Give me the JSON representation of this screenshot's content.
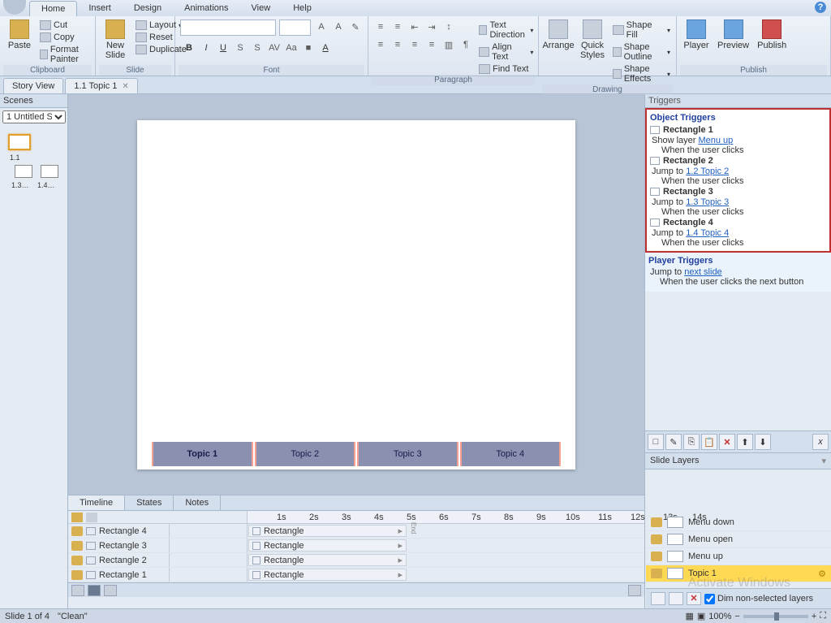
{
  "menu": {
    "tabs": [
      "Home",
      "Insert",
      "Design",
      "Animations",
      "View",
      "Help"
    ],
    "active": "Home"
  },
  "ribbon": {
    "clipboard": {
      "title": "Clipboard",
      "paste": "Paste",
      "cut": "Cut",
      "copy": "Copy",
      "painter": "Format Painter"
    },
    "slide": {
      "title": "Slide",
      "new": "New\nSlide",
      "layout": "Layout",
      "reset": "Reset",
      "dup": "Duplicate"
    },
    "font": {
      "title": "Font"
    },
    "paragraph": {
      "title": "Paragraph",
      "textdir": "Text Direction",
      "align": "Align Text",
      "find": "Find Text"
    },
    "drawing": {
      "title": "Drawing",
      "arrange": "Arrange",
      "quick": "Quick\nStyles",
      "fill": "Shape Fill",
      "outline": "Shape Outline",
      "effects": "Shape Effects"
    },
    "publish": {
      "title": "Publish",
      "player": "Player",
      "preview": "Preview",
      "pub": "Publish"
    }
  },
  "doctabs": {
    "story": "Story View",
    "tab1": "1.1 Topic 1"
  },
  "scenes": {
    "title": "Scenes",
    "select": "1 Untitled S...",
    "s1": "1.1",
    "s2": "1.3…",
    "s3": "1.4…"
  },
  "topics": [
    "Topic 1",
    "Topic 2",
    "Topic 3",
    "Topic 4"
  ],
  "timeline": {
    "tabs": [
      "Timeline",
      "States",
      "Notes"
    ],
    "rows": [
      {
        "name": "Rectangle 4",
        "obj": "Rectangle"
      },
      {
        "name": "Rectangle 3",
        "obj": "Rectangle"
      },
      {
        "name": "Rectangle 2",
        "obj": "Rectangle"
      },
      {
        "name": "Rectangle 1",
        "obj": "Rectangle"
      }
    ],
    "ticks": [
      "1s",
      "2s",
      "3s",
      "4s",
      "5s",
      "6s",
      "7s",
      "8s",
      "9s",
      "10s",
      "11s",
      "12s",
      "13s",
      "14s"
    ]
  },
  "triggers": {
    "hdr": "Triggers",
    "objtitle": "Object Triggers",
    "items": [
      {
        "obj": "Rectangle 1",
        "pre": "Show layer",
        "link": "Menu up",
        "when": "When the user clicks"
      },
      {
        "obj": "Rectangle 2",
        "pre": "Jump to",
        "link": "1.2 Topic 2",
        "when": "When the user clicks"
      },
      {
        "obj": "Rectangle 3",
        "pre": "Jump to",
        "link": "1.3 Topic 3",
        "when": "When the user clicks"
      },
      {
        "obj": "Rectangle 4",
        "pre": "Jump to",
        "link": "1.4 Topic 4",
        "when": "When the user clicks"
      }
    ],
    "playertitle": "Player Triggers",
    "player": {
      "pre": "Jump to",
      "link": "next slide",
      "when": "When the user clicks the next button"
    }
  },
  "layers": {
    "hdr": "Slide Layers",
    "items": [
      "Menu down",
      "Menu open",
      "Menu up",
      "Topic 1"
    ],
    "dim": "Dim non-selected layers"
  },
  "status": {
    "slide": "Slide 1 of 4",
    "theme": "\"Clean\"",
    "zoom": "100%"
  }
}
